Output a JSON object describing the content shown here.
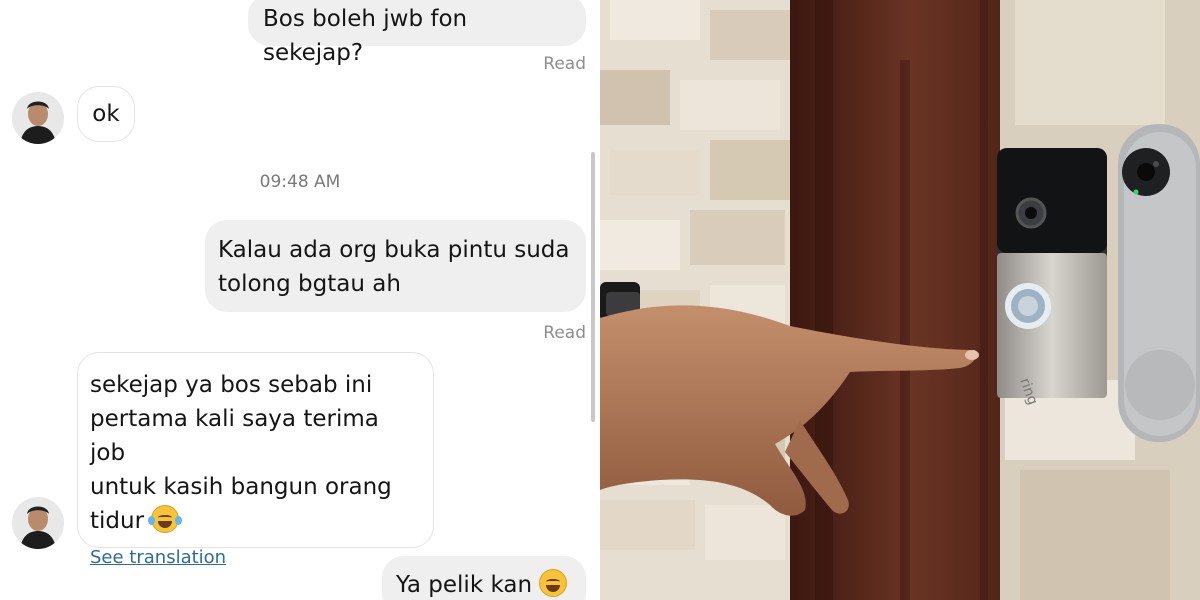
{
  "chat": {
    "messages": [
      {
        "sender": "me",
        "text": "Bos boleh jwb fon sekejap?",
        "status": "Read"
      },
      {
        "sender": "them",
        "text": "ok"
      },
      {
        "timestamp": "09:48 AM"
      },
      {
        "sender": "me",
        "lines": [
          "Kalau ada org buka pintu suda",
          "tolong bgtau ah"
        ],
        "status": "Read"
      },
      {
        "sender": "them",
        "lines": [
          "sekejap ya bos sebab ini",
          "pertama kali saya terima job",
          "untuk kasih bangun orang",
          "tidur"
        ],
        "emoji": "grinning-squinting-tears-emoji",
        "link": "See translation"
      },
      {
        "sender": "me",
        "text": "Ya pelik kan",
        "emoji": "smiling-sweat-emoji"
      }
    ]
  },
  "photo": {
    "subject": "hand pressing a video doorbell",
    "devices": [
      "ring-doorbell",
      "nest-doorbell"
    ],
    "brand_mark": "ring",
    "colors": {
      "brick": "#e2d6c4",
      "door": "#5e2b1f",
      "skin": "#b07a58"
    }
  }
}
